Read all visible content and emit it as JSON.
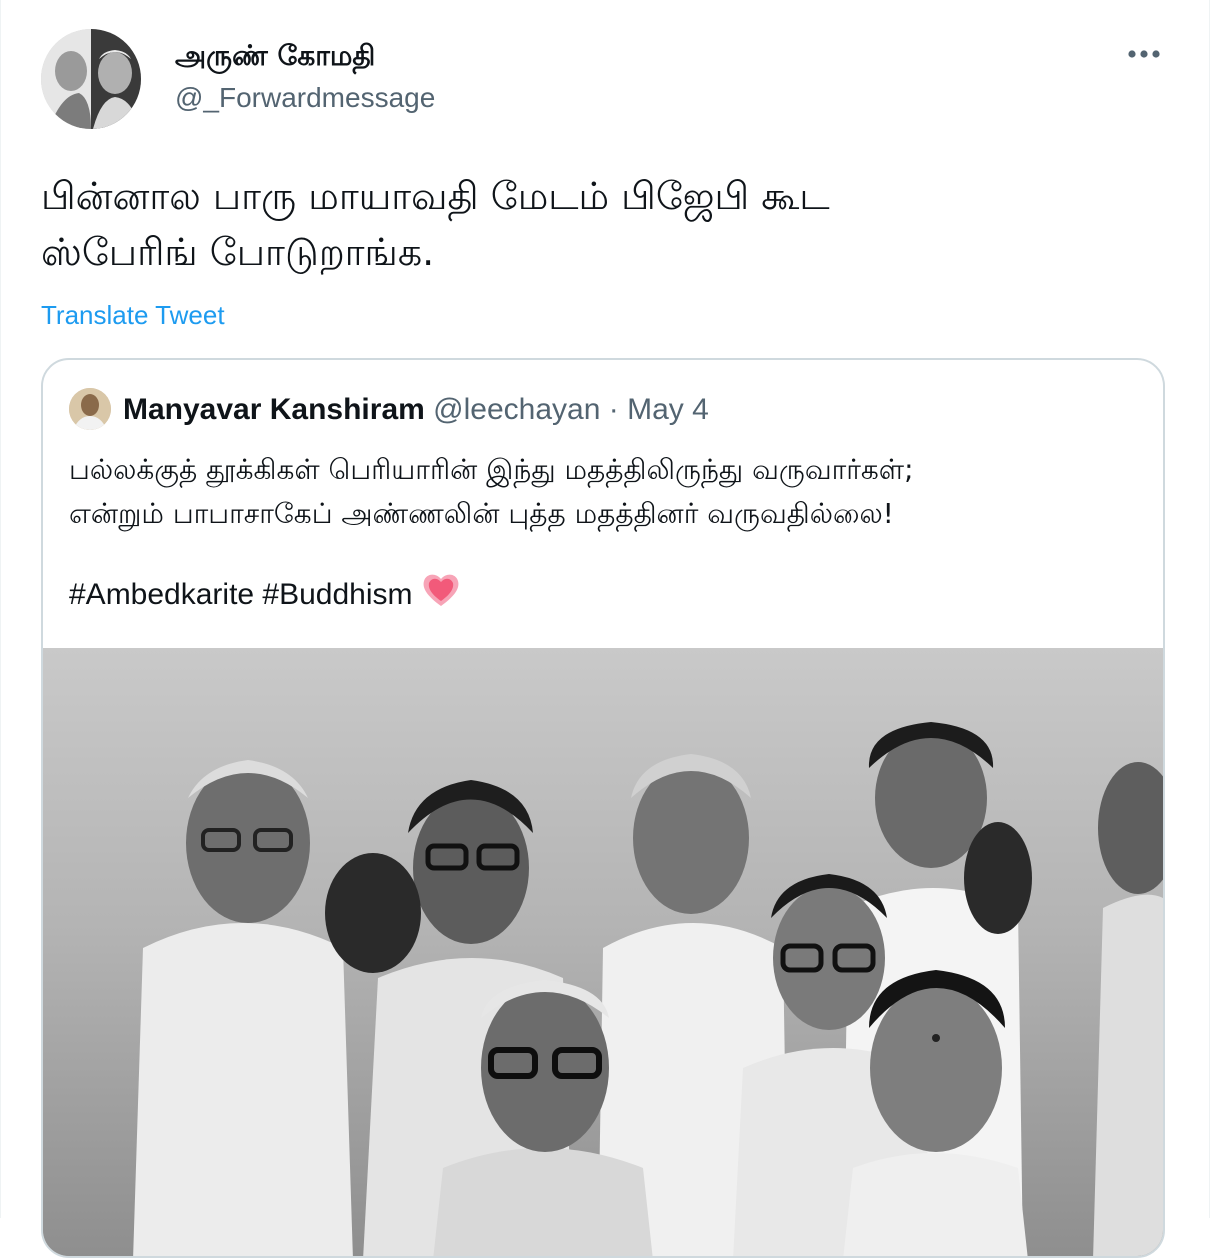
{
  "author": {
    "display_name": "அருண் கோமதி",
    "handle": "@_Forwardmessage"
  },
  "tweet": {
    "text": "பின்னால பாரு மாயாவதி மேடம் பிஜேபி கூட\nஸ்பேரிங் போடுறாங்க.",
    "translate_label": "Translate Tweet",
    "more_icon": "more-horizontal-icon"
  },
  "quoted_tweet": {
    "display_name": "Manyavar Kanshiram",
    "handle": "@leechayan",
    "separator": "·",
    "date": "May 4",
    "text_lines": [
      "பல்லக்குத் தூக்கிகள் பெரியாரின் இந்து மதத்திலிருந்து வருவார்கள்;",
      "என்றும் பாபாசாகேப் அண்ணலின் புத்த மதத்தினர் வருவதில்லை!"
    ],
    "hashtags": "#Ambedkarite #Buddhism",
    "emoji_icon": "growing-heart-icon"
  },
  "colors": {
    "link": "#1d9bf0",
    "secondary_text": "#536471",
    "border": "#cfd9de",
    "heart": "#f25a7a"
  }
}
